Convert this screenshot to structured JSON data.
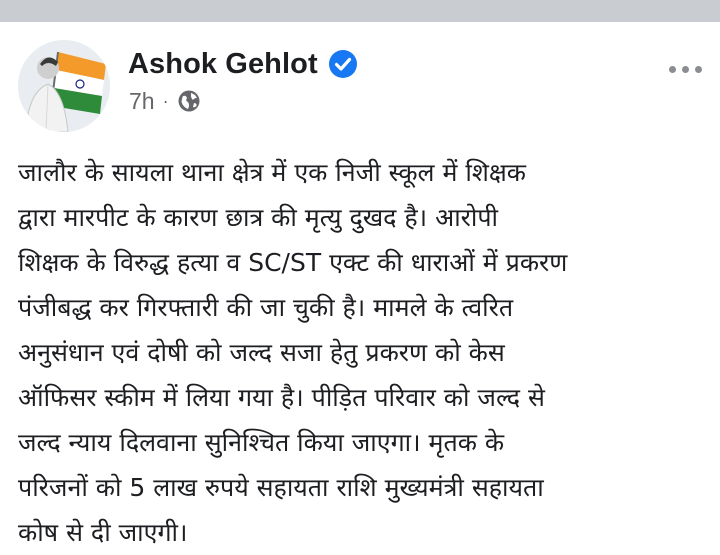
{
  "post": {
    "author": "Ashok Gehlot",
    "timestamp": "7h",
    "separator": "·",
    "privacy_icon": "globe-icon",
    "verified_icon": "verified-badge-icon",
    "menu_icon": "more-options-icon",
    "text_lines": [
      "जालौर के सायला थाना क्षेत्र में एक निजी स्कूल में शिक्षक",
      "द्वारा मारपीट के कारण छात्र की मृत्यु दुखद है। आरोपी",
      "शिक्षक के विरुद्ध हत्या व SC/ST एक्ट की धाराओं में प्रकरण",
      "पंजीबद्ध कर गिरफ्तारी की जा चुकी है। मामले के त्वरित",
      "अनुसंधान एवं दोषी को जल्द सजा हेतु प्रकरण को केस",
      "ऑफिसर स्कीम में लिया गया है। पीड़ित परिवार को जल्द से",
      "जल्द न्याय दिलवाना सुनिश्चित किया जाएगा। मृतक के",
      "परिजनों को 5 लाख रुपये सहायता राशि मुख्यमंत्री सहायता",
      "कोष से दी जाएगी।"
    ]
  },
  "colors": {
    "verified_blue": "#1877f2",
    "meta_grey": "#65676b",
    "text": "#1c1e21",
    "top_bar": "#c9ccd1"
  }
}
